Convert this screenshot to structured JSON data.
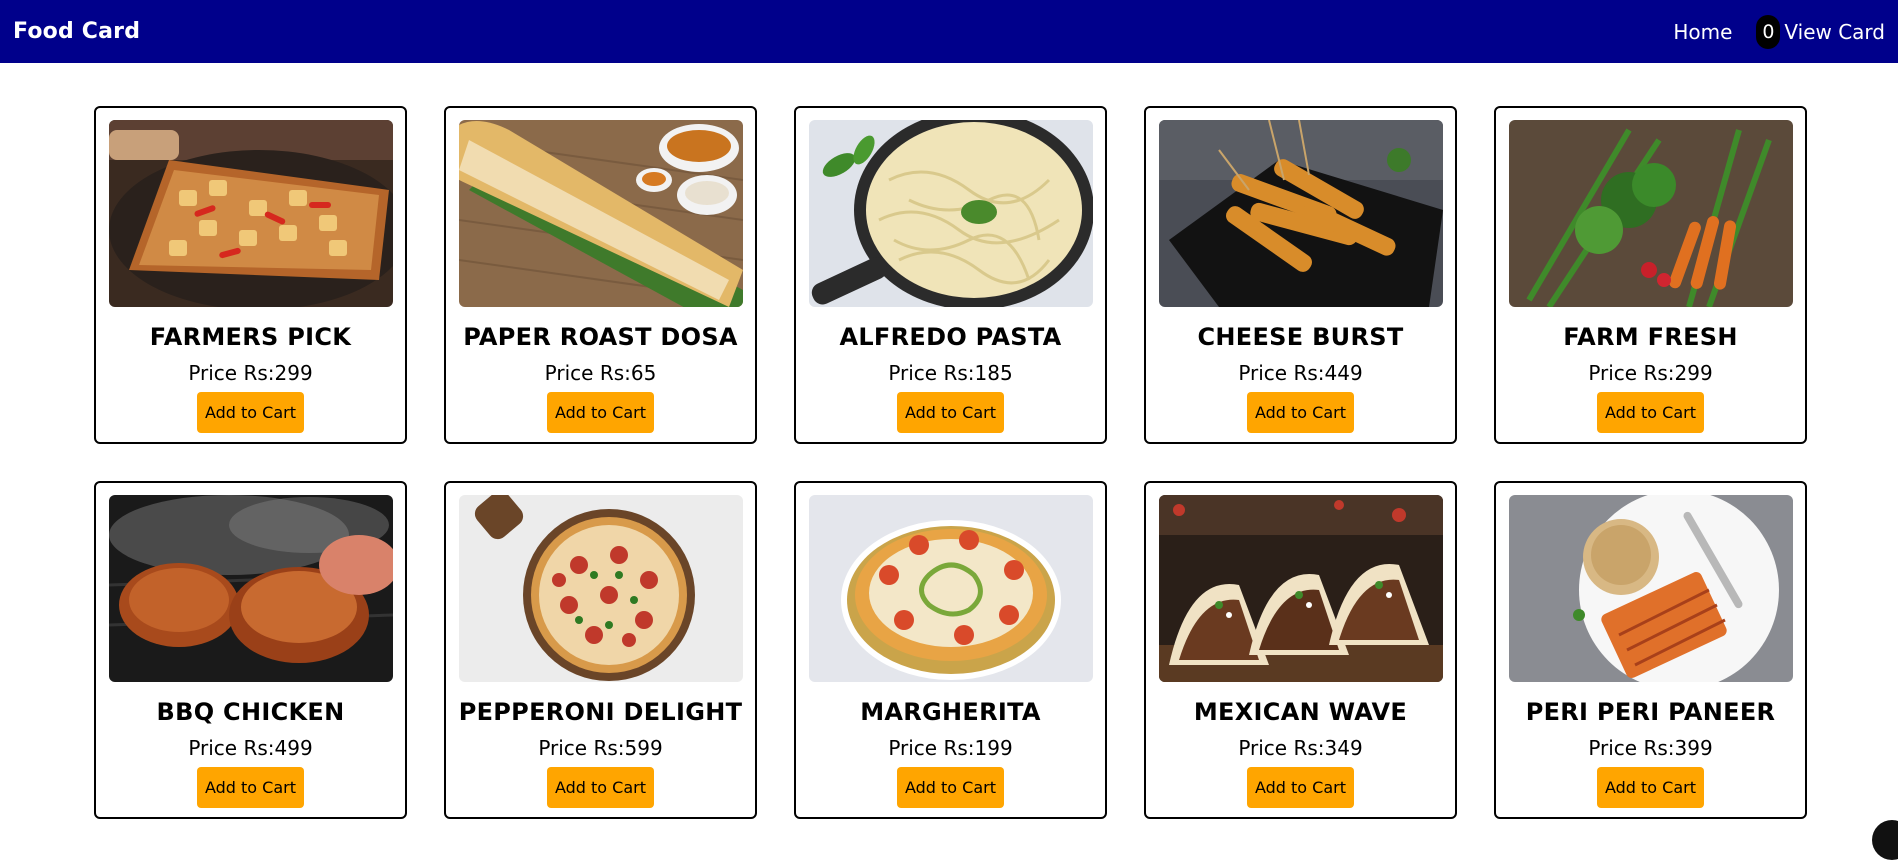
{
  "header": {
    "brand": "Food Card",
    "nav_home": "Home",
    "cart_count": "0",
    "cart_label": "View Card"
  },
  "colors": {
    "navbar": "#00008b",
    "button": "#ffa500"
  },
  "items": [
    {
      "name": "FARMERS PICK",
      "price": "Price Rs:299",
      "button": "Add to Cart",
      "image": "farmers-pick-pizza-image"
    },
    {
      "name": "PAPER ROAST DOSA",
      "price": "Price Rs:65",
      "button": "Add to Cart",
      "image": "paper-roast-dosa-image"
    },
    {
      "name": "ALFREDO PASTA",
      "price": "Price Rs:185",
      "button": "Add to Cart",
      "image": "alfredo-pasta-image"
    },
    {
      "name": "CHEESE BURST",
      "price": "Price Rs:449",
      "button": "Add to Cart",
      "image": "cheese-burst-sticks-image"
    },
    {
      "name": "FARM FRESH",
      "price": "Price Rs:299",
      "button": "Add to Cart",
      "image": "farm-fresh-vegetables-image"
    },
    {
      "name": "BBQ CHICKEN",
      "price": "Price Rs:499",
      "button": "Add to Cart",
      "image": "bbq-chicken-image"
    },
    {
      "name": "PEPPERONI DELIGHT",
      "price": "Price Rs:599",
      "button": "Add to Cart",
      "image": "pepperoni-pizza-image"
    },
    {
      "name": "MARGHERITA",
      "price": "Price Rs:199",
      "button": "Add to Cart",
      "image": "margherita-pizza-image"
    },
    {
      "name": "MEXICAN WAVE",
      "price": "Price Rs:349",
      "button": "Add to Cart",
      "image": "mexican-tacos-image"
    },
    {
      "name": "PERI PERI PANEER",
      "price": "Price Rs:399",
      "button": "Add to Cart",
      "image": "peri-peri-paneer-image"
    }
  ]
}
